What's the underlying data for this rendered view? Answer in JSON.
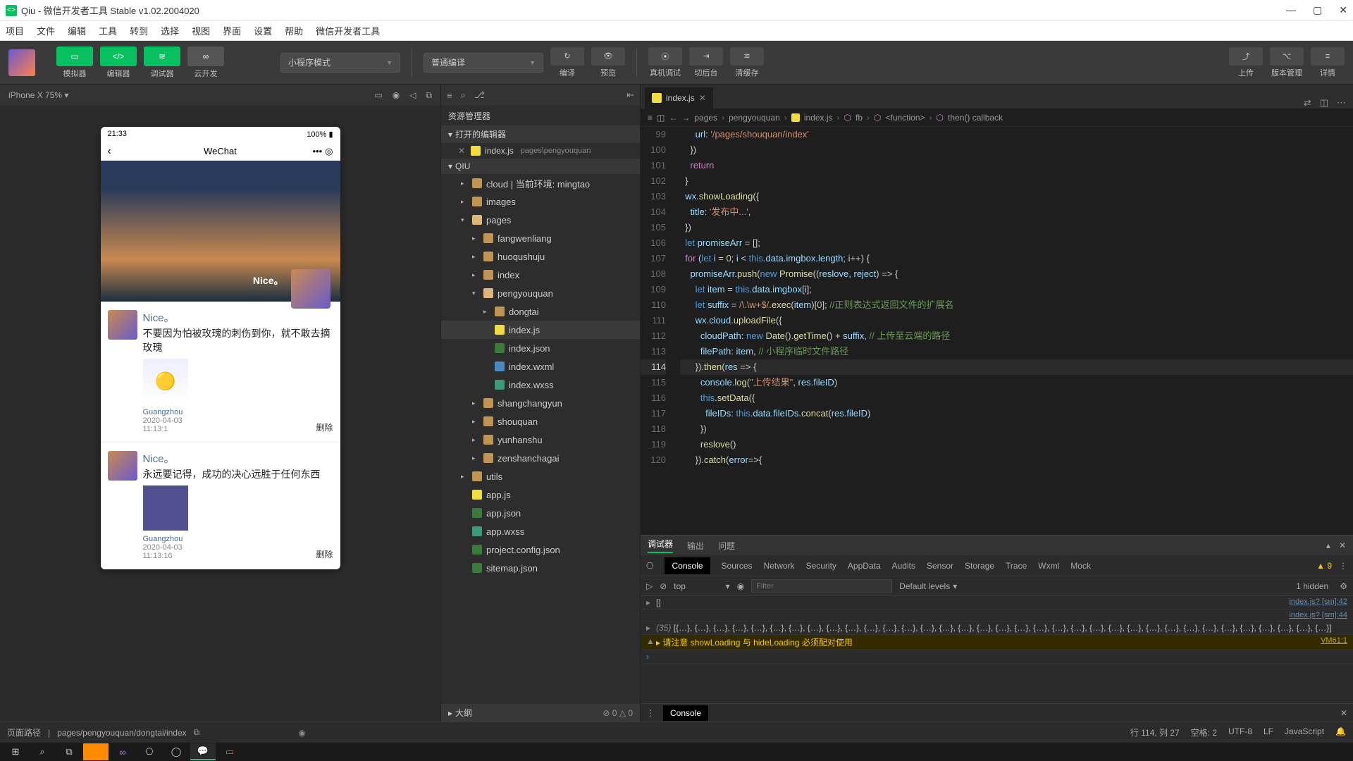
{
  "titlebar": {
    "title": "Qiu - 微信开发者工具 Stable v1.02.2004020"
  },
  "menubar": [
    "项目",
    "文件",
    "编辑",
    "工具",
    "转到",
    "选择",
    "视图",
    "界面",
    "设置",
    "帮助",
    "微信开发者工具"
  ],
  "toolbar": {
    "simulator": "模拟器",
    "editor": "编辑器",
    "debugger": "调试器",
    "cloud": "云开发",
    "mode": "小程序模式",
    "compile_mode": "普通编译",
    "compile": "编译",
    "preview": "预览",
    "remote": "真机调试",
    "bg": "切后台",
    "clear": "清缓存",
    "upload": "上传",
    "version": "版本管理",
    "details": "详情"
  },
  "sim": {
    "device": "iPhone X 75%"
  },
  "phone": {
    "time": "21:33",
    "signal": "100%",
    "nav_title": "WeChat",
    "hero_caption": "Nice。",
    "posts": [
      {
        "name": "Nice。",
        "text": "不要因为怕被玫瑰的刺伤到你，就不敢去摘玫瑰",
        "loc": "Guangzhou",
        "date": "2020-04-03",
        "t": "11:13:1",
        "del": "删除"
      },
      {
        "name": "Nice。",
        "text": "永远要记得，成功的决心远胜于任何东西",
        "loc": "Guangzhou",
        "date": "2020-04-03",
        "t": "11:13:16",
        "del": "删除"
      }
    ]
  },
  "explorer": {
    "title": "资源管理器",
    "open_editors": "打开的编辑器",
    "open_file": {
      "name": "index.js",
      "path": "pages\\pengyouquan"
    },
    "root": "QIU",
    "outline": "大纲",
    "tree": {
      "cloud": "cloud | 当前环境: mingtao",
      "images": "images",
      "pages": "pages",
      "fangwenliang": "fangwenliang",
      "huoqushuju": "huoqushuju",
      "index": "index",
      "pengyouquan": "pengyouquan",
      "dongtai": "dongtai",
      "indexjs": "index.js",
      "indexjson": "index.json",
      "indexwxml": "index.wxml",
      "indexwxss": "index.wxss",
      "shangchangyun": "shangchangyun",
      "shouquan": "shouquan",
      "yunhanshu": "yunhanshu",
      "zenshanchagai": "zenshanchagai",
      "utils": "utils",
      "appjs": "app.js",
      "appjson": "app.json",
      "appwxss": "app.wxss",
      "projectconfig": "project.config.json",
      "sitemap": "sitemap.json"
    }
  },
  "editor": {
    "tab": "index.js",
    "breadcrumb": [
      "pages",
      "pengyouquan",
      "index.js",
      "fb",
      "<function>",
      "then() callback"
    ],
    "lines_start": 99,
    "lines_end": 120,
    "highlight_line": 114
  },
  "devtools": {
    "tabs1": [
      "调试器",
      "输出",
      "问题"
    ],
    "tabs2": [
      "Console",
      "Sources",
      "Network",
      "Security",
      "AppData",
      "Audits",
      "Sensor",
      "Storage",
      "Trace",
      "Wxml",
      "Mock"
    ],
    "warn_count": "9",
    "filter_placeholder": "Filter",
    "top": "top",
    "levels": "Default levels",
    "hidden": "1 hidden",
    "log1": "[]",
    "src1": "index.js? [sm]:42",
    "src2": "index.js? [sm]:44",
    "log2a": "(35) ",
    "log2b": "[{…}, {…}, {…}, {…}, {…}, {…}, {…}, {…}, {…}, {…}, {…}, {…}, {…}, {…}, {…}, {…}, {…}, {…}, {…}, {…}, {…}, {…}, {…}, {…}, {…}, {…}, {…}, {…}, {…}, {…}, {…}, {…}, {…}, {…}, {…}]",
    "warn_msg": "请注意 showLoading 与 hideLoading 必须配对使用",
    "warn_src": "VM61:1",
    "drawer": "Console"
  },
  "outline_stats": {
    "err": "0",
    "warn": "0"
  },
  "statusbar": {
    "path_label": "页面路径",
    "path": "pages/pengyouquan/dongtai/index",
    "pos": "行 114, 列 27",
    "spaces": "空格: 2",
    "enc": "UTF-8",
    "eol": "LF",
    "lang": "JavaScript"
  }
}
